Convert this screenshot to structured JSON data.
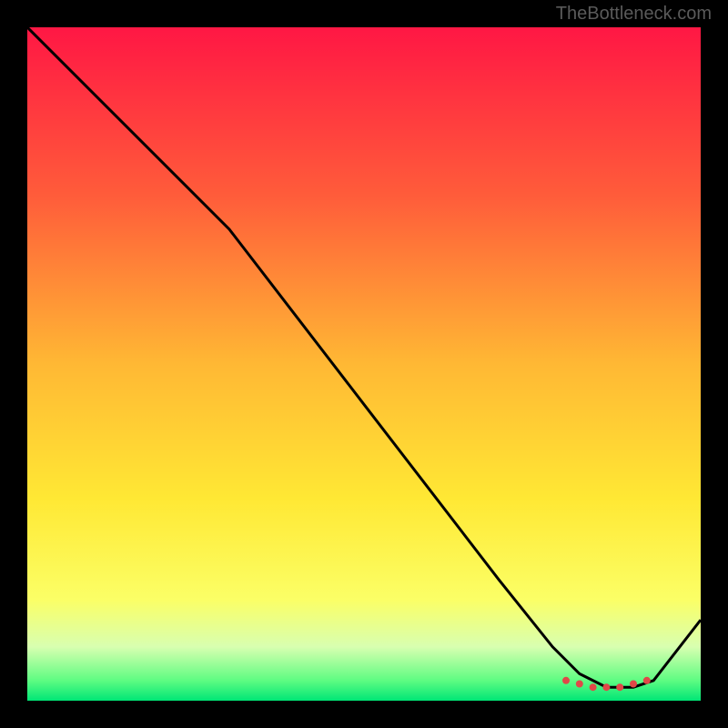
{
  "watermark": "TheBottleneck.com",
  "chart_data": {
    "type": "line",
    "title": "",
    "xlabel": "",
    "ylabel": "",
    "xlim": [
      0,
      100
    ],
    "ylim": [
      0,
      100
    ],
    "gradient_stops": [
      {
        "offset": 0,
        "color": "#ff1744"
      },
      {
        "offset": 25,
        "color": "#ff5c3a"
      },
      {
        "offset": 50,
        "color": "#ffb834"
      },
      {
        "offset": 70,
        "color": "#ffe834"
      },
      {
        "offset": 85,
        "color": "#fbff66"
      },
      {
        "offset": 92,
        "color": "#d8ffb0"
      },
      {
        "offset": 97,
        "color": "#5efc82"
      },
      {
        "offset": 100,
        "color": "#00e676"
      }
    ],
    "series": [
      {
        "name": "curve",
        "x": [
          0,
          12,
          24,
          30,
          40,
          50,
          60,
          70,
          78,
          82,
          86,
          90,
          93,
          100
        ],
        "y": [
          100,
          88,
          76,
          70,
          57,
          44,
          31,
          18,
          8,
          4,
          2,
          2,
          3,
          12
        ]
      }
    ],
    "markers": {
      "name": "bottom-dots",
      "x": [
        80,
        82,
        84,
        86,
        88,
        90,
        92
      ],
      "y": [
        3,
        2.5,
        2,
        2,
        2,
        2.5,
        3
      ],
      "color": "#e04848",
      "radius": 4
    }
  }
}
